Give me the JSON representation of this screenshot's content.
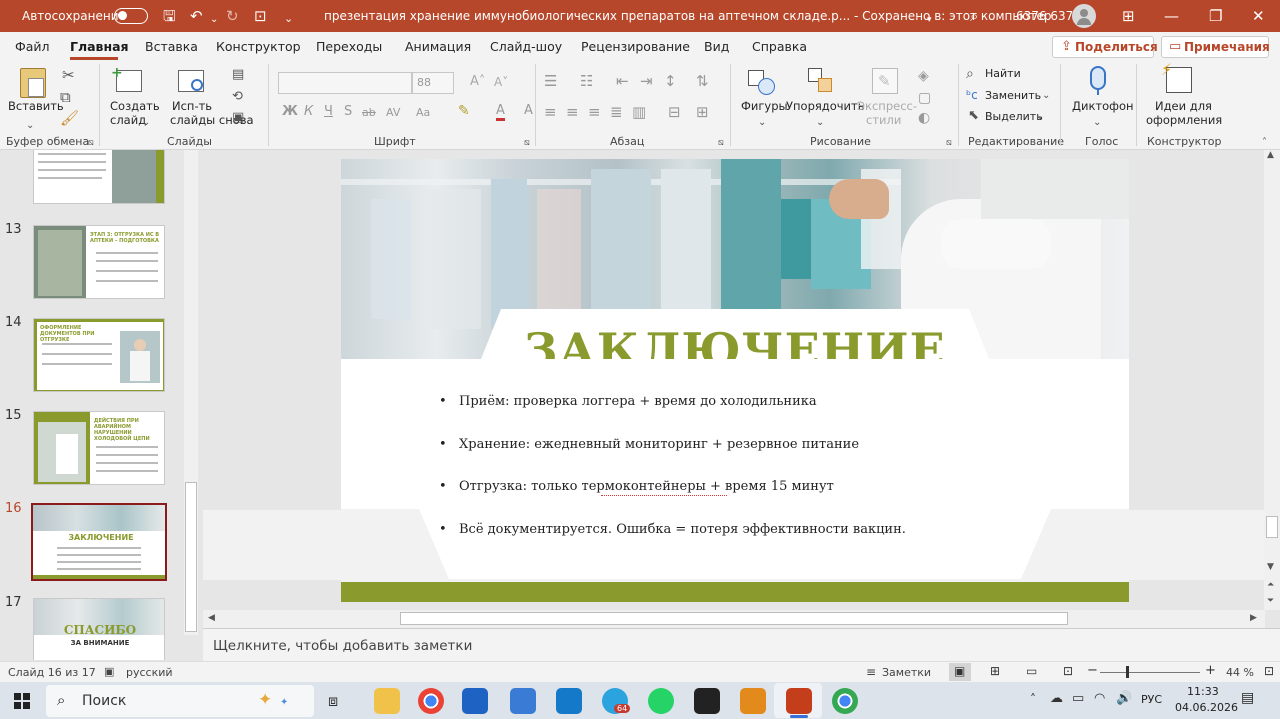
{
  "titlebar": {
    "autosave_label": "Автосохранение",
    "autosave_state": "Откл.",
    "document_title": "презентация хранение иммунобиологических препаратов на аптечном складе.р...  -  Сохранено в: этот компьютер",
    "user_name": "6376 6376"
  },
  "menu": {
    "tabs": [
      "Файл",
      "Главная",
      "Вставка",
      "Конструктор",
      "Переходы",
      "Анимация",
      "Слайд-шоу",
      "Рецензирование",
      "Вид",
      "Справка"
    ],
    "share_label": "Поделиться",
    "comments_label": "Примечания"
  },
  "ribbon": {
    "paste": "Вставить",
    "clipboard_group": "Буфер обмена",
    "new_slide_1": "Создать",
    "new_slide_2": "слайд",
    "reuse_1": "Исп-ть",
    "reuse_2": "слайды снова",
    "slides_group": "Слайды",
    "font_size": "88",
    "font_group": "Шрифт",
    "paragraph_group": "Абзац",
    "shapes": "Фигуры",
    "arrange": "Упорядочить",
    "quick_styles_1": "Экспресс-",
    "quick_styles_2": "стили",
    "drawing_group": "Рисование",
    "find": "Найти",
    "replace": "Заменить",
    "select": "Выделить",
    "editing_group": "Редактирование",
    "dictate": "Диктофон",
    "voice_group": "Голос",
    "design_ideas_1": "Идеи для",
    "design_ideas_2": "оформления",
    "designer_group": "Конструктор",
    "font_buttons": [
      "Ж",
      "К",
      "Ч",
      "S",
      "ab",
      "AV",
      "Aa",
      "A",
      "A"
    ]
  },
  "thumbnails": [
    {
      "num": "",
      "title": ""
    },
    {
      "num": "13",
      "title": "ЭТАП 3: ОТГРУЗКА ИС В АПТЕКИ – ПОДГОТОВКА"
    },
    {
      "num": "14",
      "title": "ОФОРМЛЕНИЕ ДОКУМЕНТОВ ПРИ ОТГРУЗКЕ"
    },
    {
      "num": "15",
      "title": "ДЕЙСТВИЯ ПРИ АВАРИЙНОМ НАРУШЕНИИ ХОЛОДОВОЙ ЦЕПИ"
    },
    {
      "num": "16",
      "title": "ЗАКЛЮЧЕНИЕ"
    },
    {
      "num": "17",
      "title": "СПАСИБО",
      "subtitle": "ЗА ВНИМАНИЕ"
    }
  ],
  "slide": {
    "title": "ЗАКЛЮЧЕНИЕ",
    "bullets": [
      "Приём: проверка логгера + время до холодильника",
      "Хранение: ежедневный мониторинг + резервное питание",
      "Отгрузка: только термоконтейнеры + время 15 минут",
      "Всё документируется. Ошибка = потеря эффективности вакцин."
    ],
    "colors": {
      "title": "#8a9a2c",
      "band": "#8a9a2c"
    }
  },
  "notes": {
    "placeholder": "Щелкните, чтобы добавить заметки"
  },
  "status": {
    "slide_info": "Слайд 16 из 17",
    "language": "русский",
    "notes_button": "Заметки",
    "zoom": "44 %"
  },
  "taskbar": {
    "search": "Поиск",
    "lang": "РУС",
    "time": "11:33",
    "date": "04.06.2026",
    "telegram_badge": "64"
  }
}
